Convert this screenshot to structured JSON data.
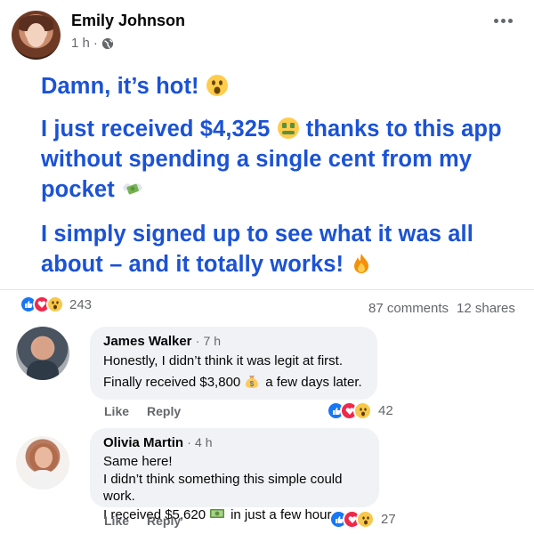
{
  "post": {
    "author": "Emily Johnson",
    "time": "1 h",
    "separator": "·",
    "icons": {
      "more": "more-icon",
      "audience": "globe-icon"
    },
    "body": {
      "line1": "Damn, it’s hot!",
      "line2_a": "I just received $4,325",
      "line2_b": "thanks to this app without spending a single cent from my pocket",
      "line3": "I simply signed up to see what it was all about – and it totally works!"
    },
    "emojis": [
      "astonished-face-emoji",
      "money-mouth-face-emoji",
      "money-with-wings-emoji",
      "fire-emoji"
    ],
    "reactions": {
      "types": [
        "like",
        "love",
        "wow"
      ],
      "count": "243"
    },
    "comments_count": "87 comments",
    "shares_count": "12 shares"
  },
  "comments": [
    {
      "name": "James Walker",
      "time": "7 h",
      "line1": "Honestly, I didn’t think it was legit at first.",
      "line2_a": "Finally received $3,800",
      "line2_b": "a few days later.",
      "emoji": "money-bag-emoji",
      "like_label": "Like",
      "reply_label": "Reply",
      "reaction_count": "42"
    },
    {
      "name": "Olivia Martin",
      "time": "4 h",
      "line1": "Same here!",
      "line2": "I didn’t think something this simple could work.",
      "line3_a": "I received $5,620",
      "line3_b": "in just a few hours.",
      "emoji": "dollar-banknote-emoji",
      "like_label": "Like",
      "reply_label": "Reply",
      "reaction_count": "27"
    }
  ],
  "colors": {
    "post_text": "#1b52d6",
    "secondary": "#65676b",
    "bubble": "#f0f2f5",
    "like": "#1877f2",
    "love": "#f0284a",
    "wow": "#f7c84b"
  }
}
